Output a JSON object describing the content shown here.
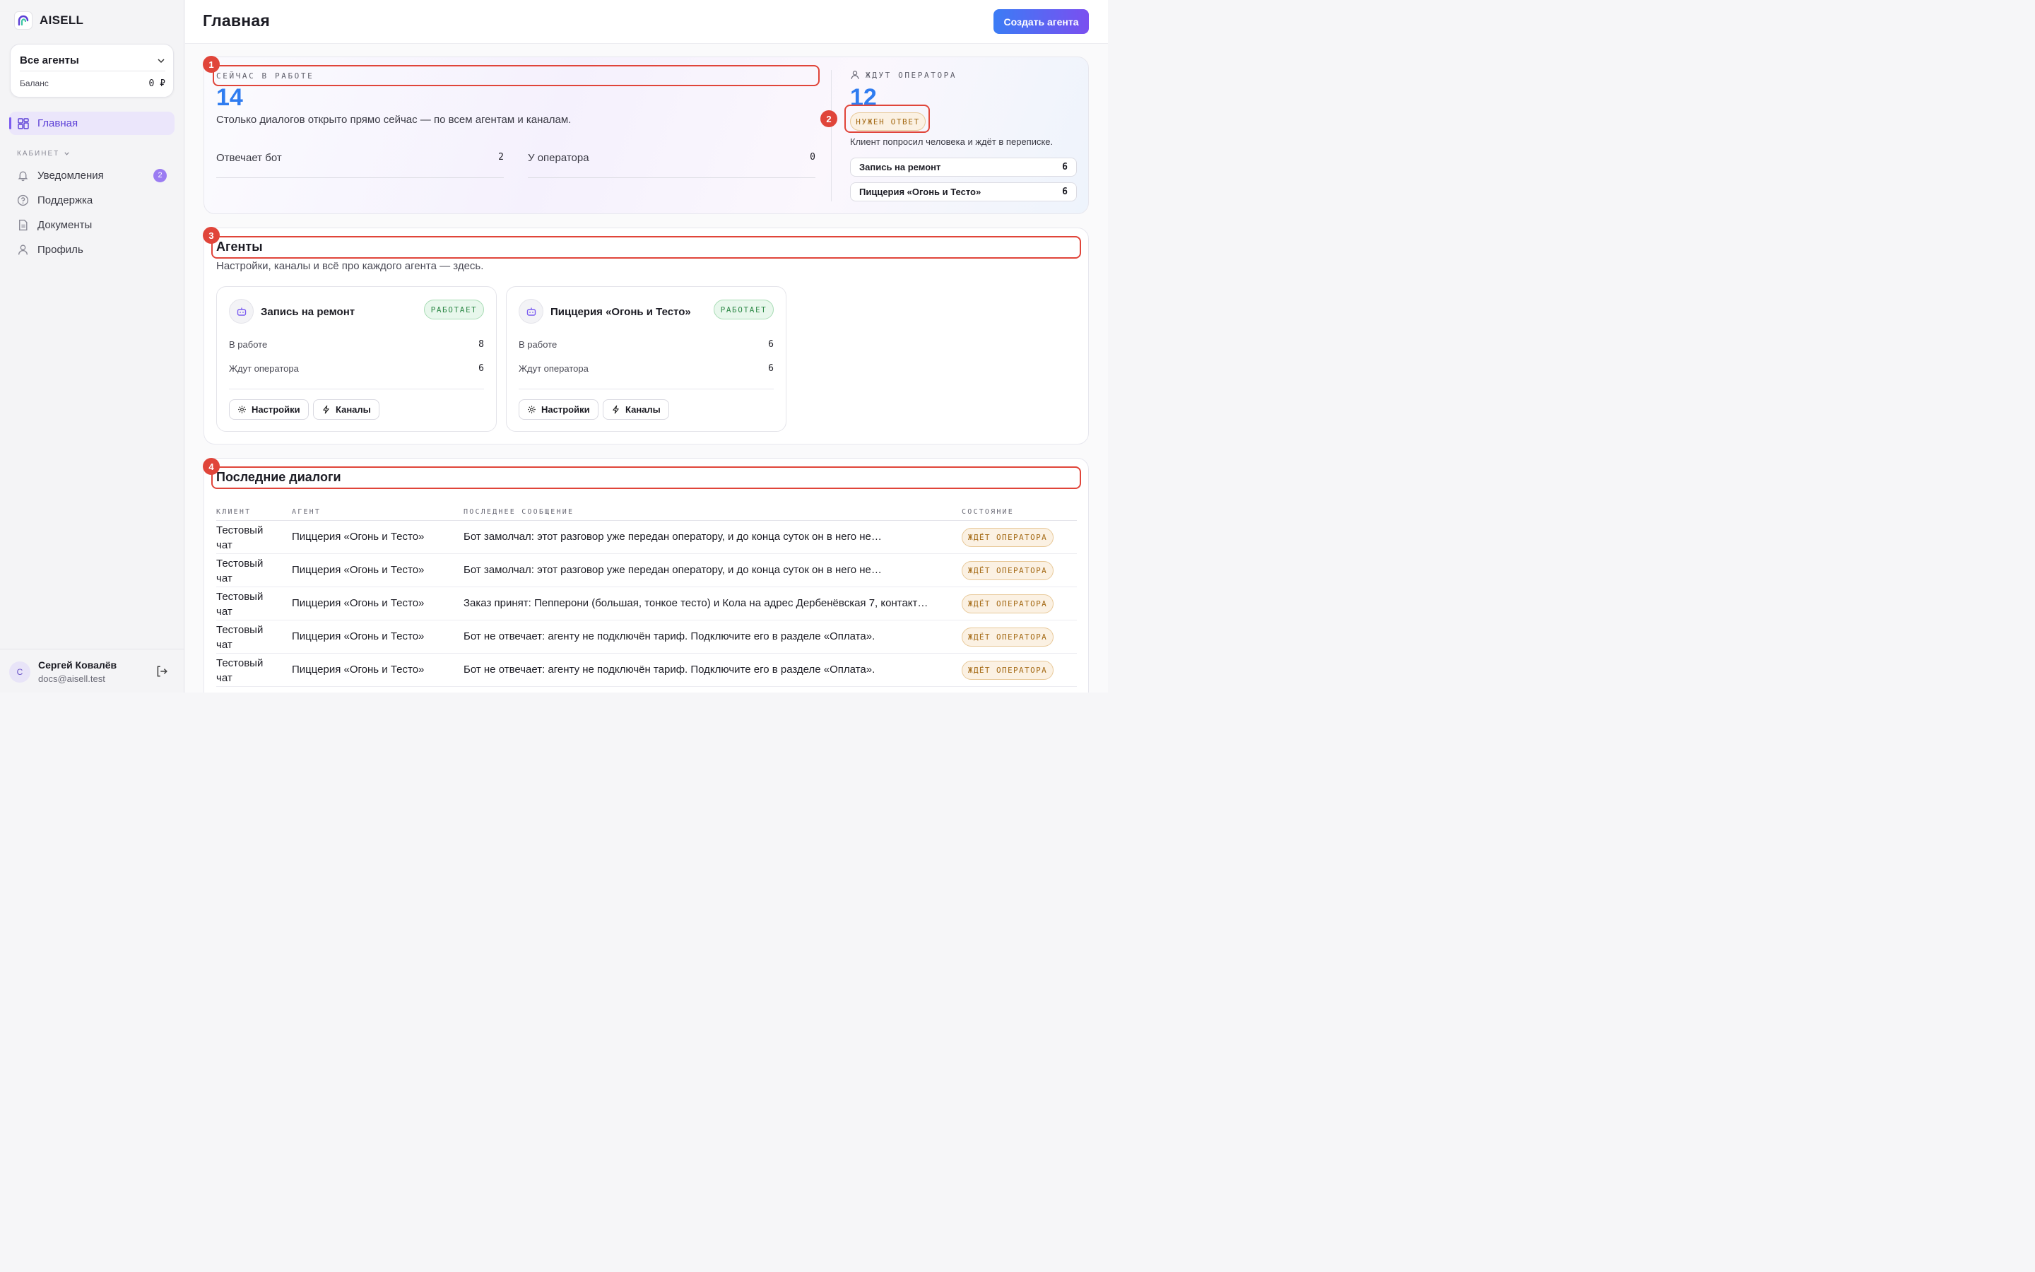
{
  "brand": {
    "name": "AISELL"
  },
  "sidebar": {
    "agent_select": "Все агенты",
    "balance_label": "Баланс",
    "balance_value": "0 ₽",
    "main_item": "Главная",
    "section_label": "КАБИНЕТ",
    "items": [
      {
        "label": "Уведомления",
        "badge": "2"
      },
      {
        "label": "Поддержка"
      },
      {
        "label": "Документы"
      },
      {
        "label": "Профиль"
      }
    ],
    "user": {
      "initial": "С",
      "name": "Сергей Ковалёв",
      "email": "docs@aisell.test"
    }
  },
  "header": {
    "title": "Главная",
    "create_button": "Создать агента"
  },
  "stats": {
    "in_work": {
      "label": "СЕЙЧАС В РАБОТЕ",
      "value": "14",
      "description": "Столько диалогов открыто прямо сейчас — по всем агентам и каналам.",
      "bot_label": "Отвечает бот",
      "bot_value": "2",
      "operator_label": "У оператора",
      "operator_value": "0"
    },
    "waiting": {
      "label": "ЖДУТ ОПЕРАТОРА",
      "value": "12",
      "pill": "НУЖЕН ОТВЕТ",
      "description": "Клиент попросил человека и ждёт в переписке.",
      "rows": [
        {
          "name": "Запись на ремонт",
          "count": "6"
        },
        {
          "name": "Пиццерия «Огонь и Тесто»",
          "count": "6"
        }
      ]
    }
  },
  "annotations": [
    "1",
    "2",
    "3",
    "4"
  ],
  "agents_section": {
    "title": "Агенты",
    "subtitle": "Настройки, каналы и всё про каждого агента — здесь.",
    "cards": [
      {
        "name": "Запись на ремонт",
        "status": "РАБОТАЕТ",
        "in_work_label": "В работе",
        "in_work": "8",
        "waiting_label": "Ждут оператора",
        "waiting": "6",
        "settings": "Настройки",
        "channels": "Каналы"
      },
      {
        "name": "Пиццерия «Огонь и Тесто»",
        "status": "РАБОТАЕТ",
        "in_work_label": "В работе",
        "in_work": "6",
        "waiting_label": "Ждут оператора",
        "waiting": "6",
        "settings": "Настройки",
        "channels": "Каналы"
      }
    ]
  },
  "dialogs_section": {
    "title": "Последние диалоги",
    "columns": [
      "КЛИЕНТ",
      "АГЕНТ",
      "ПОСЛЕДНЕЕ СООБЩЕНИЕ",
      "СОСТОЯНИЕ"
    ],
    "rows": [
      {
        "client": "Тестовый чат",
        "agent": "Пиццерия «Огонь и Тесто»",
        "message": "Бот замолчал: этот разговор уже передан оператору, и до конца суток он в него не…",
        "status": "ЖДЁТ ОПЕРАТОРА"
      },
      {
        "client": "Тестовый чат",
        "agent": "Пиццерия «Огонь и Тесто»",
        "message": "Бот замолчал: этот разговор уже передан оператору, и до конца суток он в него не…",
        "status": "ЖДЁТ ОПЕРАТОРА"
      },
      {
        "client": "Тестовый чат",
        "agent": "Пиццерия «Огонь и Тесто»",
        "message": "Заказ принят: Пепперони (большая, тонкое тесто) и Кола на адрес Дербенёвская 7, контакт…",
        "status": "ЖДЁТ ОПЕРАТОРА"
      },
      {
        "client": "Тестовый чат",
        "agent": "Пиццерия «Огонь и Тесто»",
        "message": "Бот не отвечает: агенту не подключён тариф. Подключите его в разделе «Оплата».",
        "status": "ЖДЁТ ОПЕРАТОРА"
      },
      {
        "client": "Тестовый чат",
        "agent": "Пиццерия «Огонь и Тесто»",
        "message": "Бот не отвечает: агенту не подключён тариф. Подключите его в разделе «Оплата».",
        "status": "ЖДЁТ ОПЕРАТОРА"
      }
    ]
  }
}
